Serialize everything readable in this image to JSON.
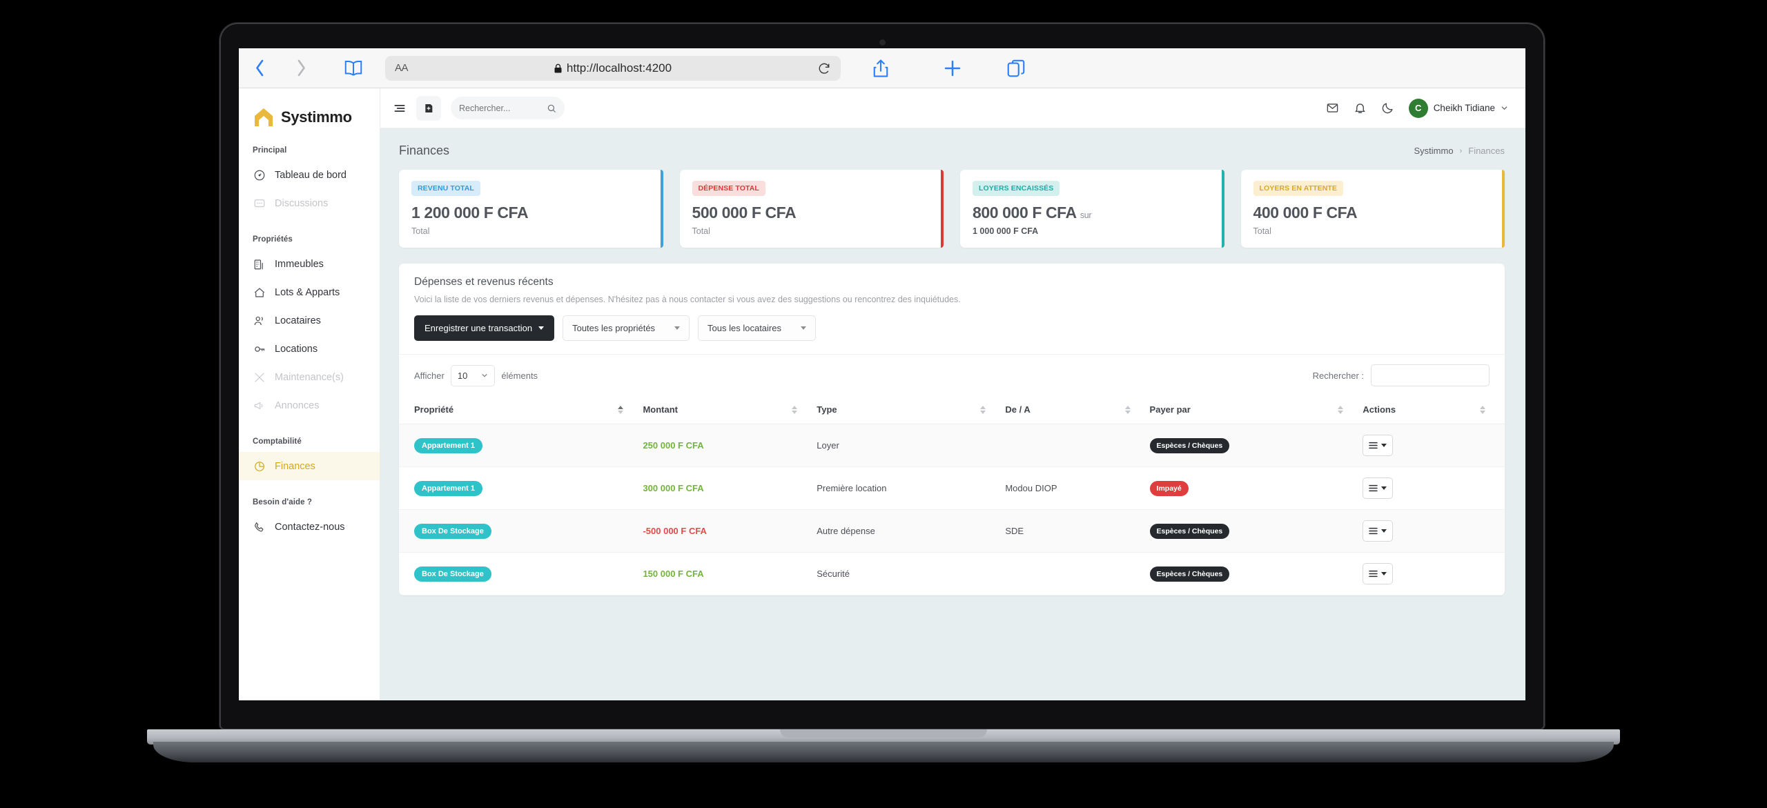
{
  "browser": {
    "url": "http://localhost:4200",
    "text_size_label": "AA",
    "icons": [
      "back-chevron",
      "forward-chevron",
      "bookmarks-book",
      "lock",
      "reload",
      "share",
      "new-tab-plus",
      "tabs-overview"
    ]
  },
  "sidebar": {
    "brand": "Systimmo",
    "sections": [
      {
        "label": "Principal",
        "items": [
          {
            "label": "Tableau de bord",
            "icon": "gauge-icon",
            "state": "normal",
            "name": "dashboard"
          },
          {
            "label": "Discussions",
            "icon": "chat-icon",
            "state": "muted",
            "name": "discussions"
          }
        ]
      },
      {
        "label": "Propriétés",
        "items": [
          {
            "label": "Immeubles",
            "icon": "building-icon",
            "state": "normal",
            "name": "immeubles"
          },
          {
            "label": "Lots & Apparts",
            "icon": "home-icon",
            "state": "normal",
            "name": "lots-apparts"
          },
          {
            "label": "Locataires",
            "icon": "users-icon",
            "state": "normal",
            "name": "locataires"
          },
          {
            "label": "Locations",
            "icon": "key-icon",
            "state": "normal",
            "name": "locations"
          },
          {
            "label": "Maintenance(s)",
            "icon": "tools-icon",
            "state": "muted",
            "name": "maintenances"
          },
          {
            "label": "Annonces",
            "icon": "megaphone-icon",
            "state": "muted",
            "name": "annonces"
          }
        ]
      },
      {
        "label": "Comptabilité",
        "items": [
          {
            "label": "Finances",
            "icon": "pie-chart-icon",
            "state": "active",
            "name": "finances"
          }
        ]
      },
      {
        "label": "Besoin d'aide ?",
        "items": [
          {
            "label": "Contactez-nous",
            "icon": "phone-icon",
            "state": "normal",
            "name": "contactez-nous"
          }
        ]
      }
    ]
  },
  "topbar": {
    "search_placeholder": "Rechercher...",
    "user_name": "Cheikh Tidiane",
    "user_initial": "C",
    "avatar_color": "#2f7d32",
    "icons": [
      "menu-burger-icon",
      "add-panel-icon",
      "search-icon",
      "mail-icon",
      "bell-icon",
      "moon-icon",
      "chevron-down-icon"
    ]
  },
  "page": {
    "title": "Finances",
    "breadcrumb": {
      "root": "Systimmo",
      "separator": "›",
      "current": "Finances"
    }
  },
  "stats": [
    {
      "badge": "REVENU TOTAL",
      "value": "1 200 000 F CFA",
      "suffix": "",
      "sub": "Total",
      "sub_bold": false,
      "accent": "#3aa2e0",
      "badge_bg": "#d6ecfa",
      "badge_fg": "#2e9bdb"
    },
    {
      "badge": "DÉPENSE TOTAL",
      "value": "500 000 F CFA",
      "suffix": "",
      "sub": "Total",
      "sub_bold": false,
      "accent": "#d93a3a",
      "badge_bg": "#fadddd",
      "badge_fg": "#d63b3b"
    },
    {
      "badge": "LOYERS ENCAISSÉS",
      "value": "800 000 F CFA",
      "suffix": "sur",
      "sub": "1 000 000 F CFA",
      "sub_bold": true,
      "accent": "#23b3ae",
      "badge_bg": "#d4f0ee",
      "badge_fg": "#1fa9a4"
    },
    {
      "badge": "LOYERS EN ATTENTE",
      "value": "400 000 F CFA",
      "suffix": "",
      "sub": "Total",
      "sub_bold": false,
      "accent": "#e8b93c",
      "badge_bg": "#fbefd0",
      "badge_fg": "#d9a82b"
    }
  ],
  "panel": {
    "title": "Dépenses et revenus récents",
    "description": "Voici la liste de vos derniers revenus et dépenses. N'hésitez pas à nous contacter si vous avez des suggestions ou rencontrez des inquiétudes.",
    "primary_button": "Enregistrer une transaction",
    "filter_properties": "Toutes les propriétés",
    "filter_tenants": "Tous les locataires"
  },
  "table_controls": {
    "show_label": "Afficher",
    "page_length": "10",
    "entries_label": "éléments",
    "search_label": "Rechercher :",
    "search_value": ""
  },
  "table": {
    "columns": [
      "Propriété",
      "Montant",
      "Type",
      "De / A",
      "Payer par",
      "Actions"
    ],
    "sorted_column": 0,
    "rows": [
      {
        "propriete": "Appartement 1",
        "montant": "250 000 F CFA",
        "montant_sign": "pos",
        "type": "Loyer",
        "de_a": "",
        "payer_par": "Espèces / Chèques",
        "payer_style": "dark"
      },
      {
        "propriete": "Appartement 1",
        "montant": "300 000 F CFA",
        "montant_sign": "pos",
        "type": "Première location",
        "de_a": "Modou DIOP",
        "payer_par": "Impayé",
        "payer_style": "red"
      },
      {
        "propriete": "Box De Stockage",
        "montant": "-500 000 F CFA",
        "montant_sign": "neg",
        "type": "Autre dépense",
        "de_a": "SDE",
        "payer_par": "Espèces / Chèques",
        "payer_style": "dark"
      },
      {
        "propriete": "Box De Stockage",
        "montant": "150 000 F CFA",
        "montant_sign": "pos",
        "type": "Sécurité",
        "de_a": "",
        "payer_par": "Espèces / Chèques",
        "payer_style": "dark"
      }
    ]
  }
}
